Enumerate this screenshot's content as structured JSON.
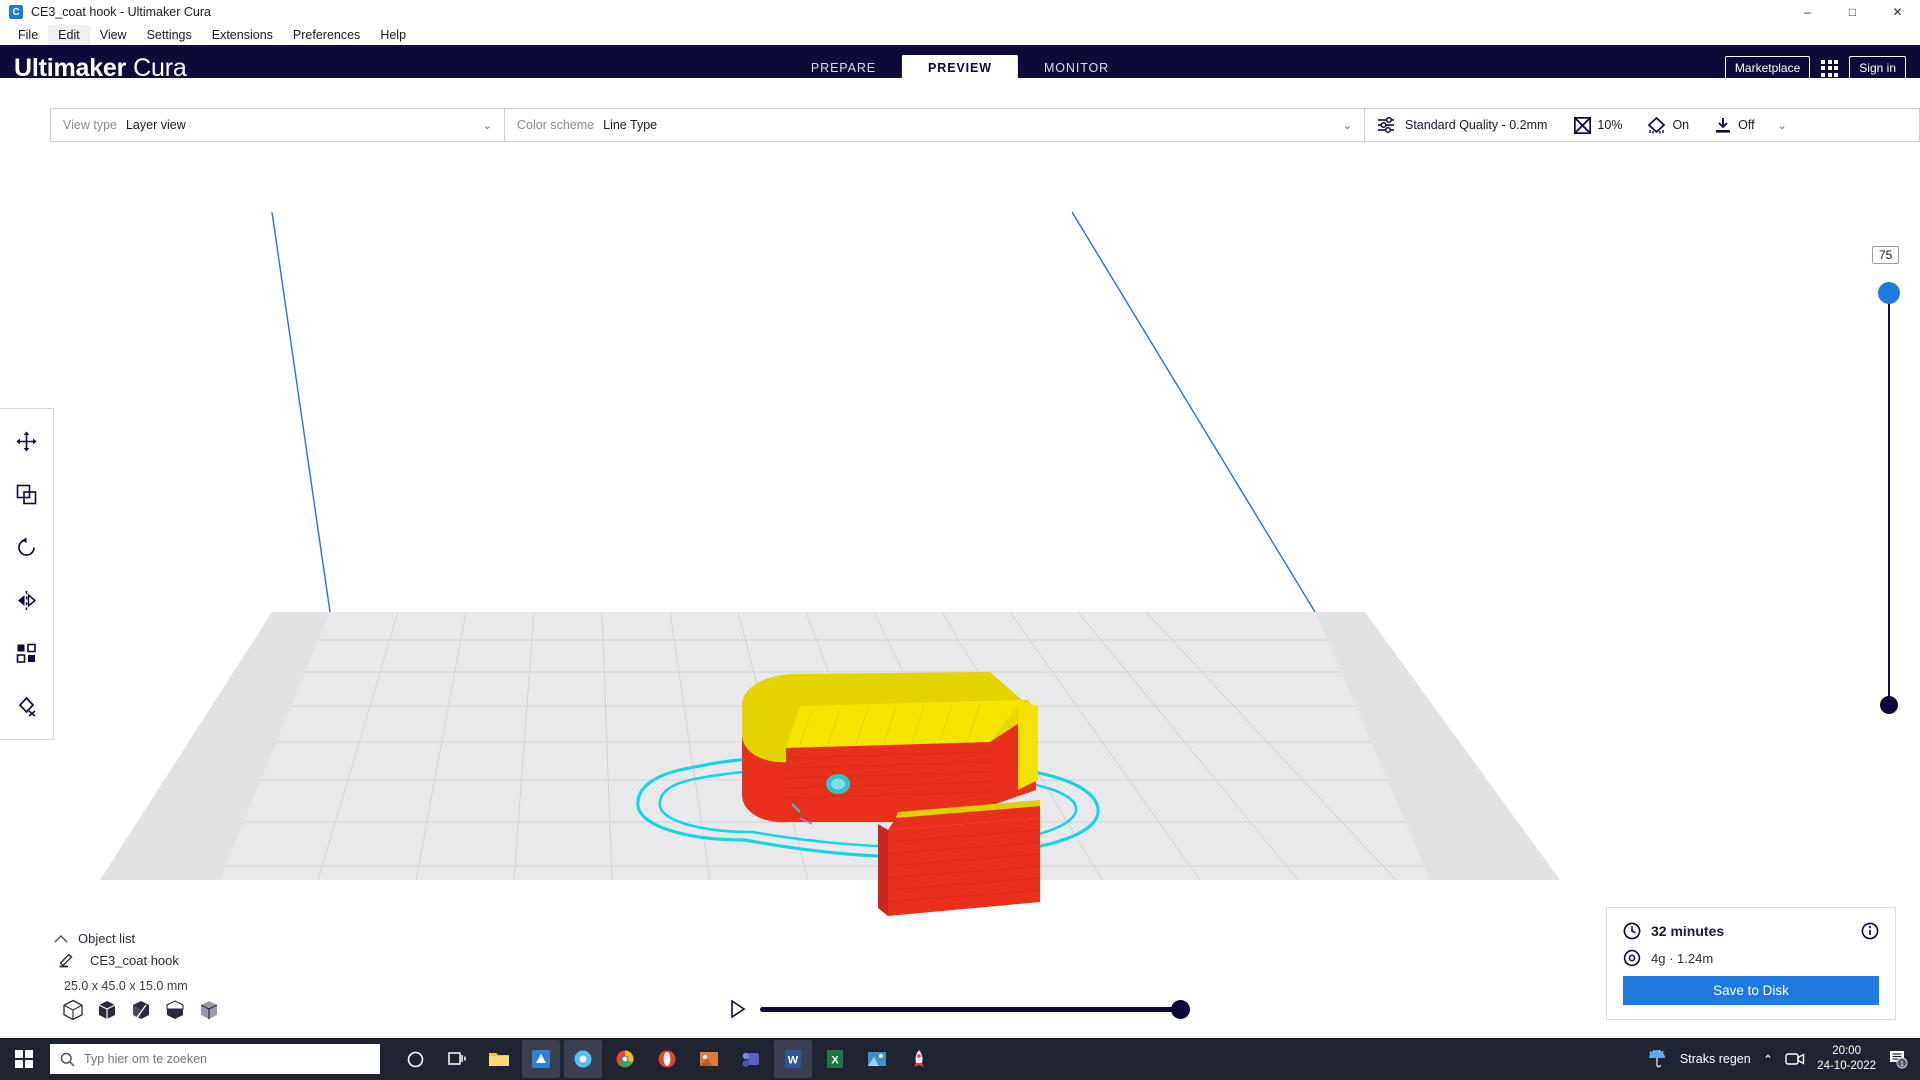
{
  "window": {
    "title": "CE3_coat hook - Ultimaker Cura",
    "app_icon": "cura-app-icon",
    "minimize": "–",
    "maximize": "□",
    "close": "✕"
  },
  "menubar": {
    "items": [
      {
        "label": "File",
        "active": false
      },
      {
        "label": "Edit",
        "active": true
      },
      {
        "label": "View",
        "active": false
      },
      {
        "label": "Settings",
        "active": false
      },
      {
        "label": "Extensions",
        "active": false
      },
      {
        "label": "Preferences",
        "active": false
      },
      {
        "label": "Help",
        "active": false
      }
    ]
  },
  "topbar": {
    "brand_bold": "Ultimaker",
    "brand_light": "Cura",
    "background": "#0c0b3a",
    "tabs": [
      {
        "label": "PREPARE",
        "active": false
      },
      {
        "label": "PREVIEW",
        "active": true
      },
      {
        "label": "MONITOR",
        "active": false
      }
    ],
    "marketplace": "Marketplace",
    "signin": "Sign in",
    "apps_icon": "apps-grid-icon"
  },
  "viewbar": {
    "view_type_label": "View type",
    "view_type_value": "Layer view",
    "color_scheme_label": "Color scheme",
    "color_scheme_value": "Line Type",
    "chevron": "⌄",
    "profile_icon": "print-settings-icon",
    "profile": "Standard Quality - 0.2mm",
    "infill_icon": "infill-icon",
    "infill": "10%",
    "support_icon": "support-icon",
    "support": "On",
    "adhesion_icon": "adhesion-icon",
    "adhesion": "Off"
  },
  "tools": [
    {
      "name": "move-tool",
      "icon": "✥"
    },
    {
      "name": "scale-tool",
      "icon": "⤢"
    },
    {
      "name": "rotate-tool",
      "icon": "↺"
    },
    {
      "name": "mirror-tool",
      "icon": "▶◀"
    },
    {
      "name": "per-model-settings-tool",
      "icon": "⌗"
    },
    {
      "name": "support-blocker-tool",
      "icon": "◇"
    }
  ],
  "object_list": {
    "collapse_icon": "chevron-up-icon",
    "title": "Object list",
    "item_icon": "pencil-icon",
    "item_name": "CE3_coat hook",
    "dimensions": "25.0 x 45.0 x 15.0 mm",
    "shape_icons": [
      "cube-outline-icon",
      "cube-filled-icon",
      "cube-cut-icon",
      "cube-half-icon",
      "cube-wire-icon"
    ]
  },
  "layer_slider": {
    "value": "75",
    "top_handle_color": "#1f7ae0",
    "bottom_handle_color": "#0c0b3a"
  },
  "timeline": {
    "play_icon": "play-icon",
    "handle_color": "#0c0b3a"
  },
  "print_info": {
    "time_icon": "clock-icon",
    "time": "32 minutes",
    "material_icon": "spool-icon",
    "material": "4g · 1.24m",
    "info_icon": "info-icon",
    "save_button": "Save to Disk",
    "accent": "#1f7ae0"
  },
  "taskbar": {
    "start_icon": "windows-logo-icon",
    "search_icon": "search-icon",
    "search_placeholder": "Typ hier om te zoeken",
    "apps": [
      {
        "name": "cortana-icon",
        "glyph": "○",
        "color": "#ffffff",
        "active": false
      },
      {
        "name": "task-view-icon",
        "glyph": "⧉",
        "color": "#ffffff",
        "active": false
      },
      {
        "name": "file-explorer-icon",
        "glyph": "📁",
        "color": "#f5c242",
        "active": false
      },
      {
        "name": "cura-taskbar-icon",
        "glyph": "▣",
        "color": "#2f80d0",
        "active": true
      },
      {
        "name": "chrome-canary-icon",
        "glyph": "C",
        "color": "#4fc3f7",
        "active": true
      },
      {
        "name": "chrome-icon",
        "glyph": "◉",
        "color": "#4285f4",
        "active": false
      },
      {
        "name": "opera-icon",
        "glyph": "O",
        "color": "#e8412f",
        "active": false
      },
      {
        "name": "photos-icon",
        "glyph": "▤",
        "color": "#e07a3f",
        "active": false
      },
      {
        "name": "teams-icon",
        "glyph": "◰",
        "color": "#5b5fc7",
        "active": false
      },
      {
        "name": "word-icon",
        "glyph": "W",
        "color": "#2b579a",
        "active": true
      },
      {
        "name": "excel-icon",
        "glyph": "X",
        "color": "#217346",
        "active": false
      },
      {
        "name": "paint-icon",
        "glyph": "▧",
        "color": "#3f8fd0",
        "active": false
      },
      {
        "name": "rocket-icon",
        "glyph": "🚀",
        "color": "#d64545",
        "active": false
      }
    ],
    "weather_icon": "rain-icon",
    "weather": "Straks regen",
    "tray_chevron": "⌃",
    "meet_icon": "meet-now-icon",
    "time": "20:00",
    "date": "24-10-2022",
    "notification_icon": "notifications-icon",
    "notification_count": "1"
  }
}
